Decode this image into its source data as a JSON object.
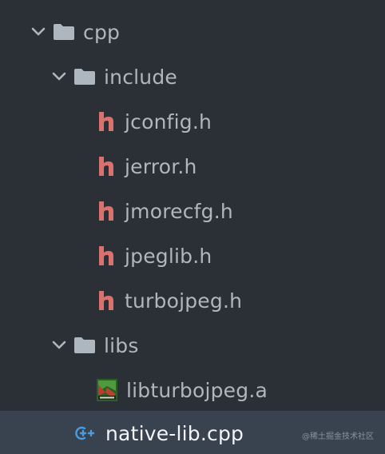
{
  "tree": {
    "cpp_folder": {
      "label": "cpp",
      "expanded": true
    },
    "include_folder": {
      "label": "include",
      "expanded": true
    },
    "headers": [
      {
        "label": "jconfig.h"
      },
      {
        "label": "jerror.h"
      },
      {
        "label": "jmorecfg.h"
      },
      {
        "label": "jpeglib.h"
      },
      {
        "label": "turbojpeg.h"
      }
    ],
    "libs_folder": {
      "label": "libs",
      "expanded": true
    },
    "lib_file": {
      "label": "libturbojpeg.a",
      "icon": "archive-icon"
    },
    "source_file": {
      "label": "native-lib.cpp",
      "icon": "cpp-file-icon",
      "selected": true
    }
  },
  "watermark": {
    "text": "@稀土掘金技术社区"
  },
  "colors": {
    "background": "#2b3036",
    "selected_row": "#394350",
    "header_icon": "#d9716f",
    "folder_icon": "#aeb6c0",
    "cpp_icon": "#4a9be0"
  }
}
